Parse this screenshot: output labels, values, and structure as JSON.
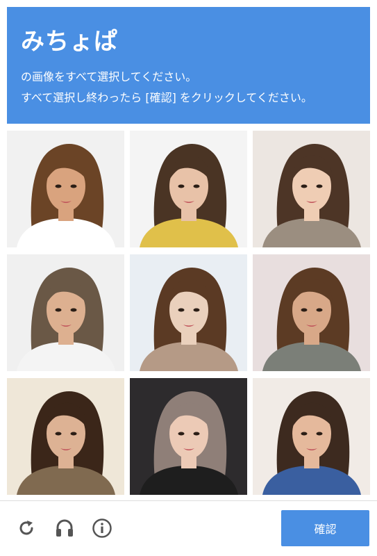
{
  "header": {
    "title": "みちょぱ",
    "instruction_line1": "の画像をすべて選択してください。",
    "instruction_line2": "すべて選択し終わったら [確認] をクリックしてください。"
  },
  "grid": {
    "rows": 3,
    "cols": 3,
    "tiles": [
      {
        "bg": "#f1f1f1",
        "hair": "#6b4426",
        "skin": "#d9a37e",
        "top": "#ffffff"
      },
      {
        "bg": "#f4f4f4",
        "hair": "#4a3424",
        "skin": "#e8c2a8",
        "top": "#e0c04a"
      },
      {
        "bg": "#ece6e1",
        "hair": "#4d3526",
        "skin": "#efcdb4",
        "top": "#9b8e80"
      },
      {
        "bg": "#f0f0f0",
        "hair": "#6a5846",
        "skin": "#ddb090",
        "top": "#f4f4f4"
      },
      {
        "bg": "#e9eef3",
        "hair": "#5b3a24",
        "skin": "#ead0bc",
        "top": "#b59a86"
      },
      {
        "bg": "#e8dede",
        "hair": "#5c3b24",
        "skin": "#d8a888",
        "top": "#7b7f78"
      },
      {
        "bg": "#efe7d8",
        "hair": "#3b2619",
        "skin": "#ddb294",
        "top": "#806a50"
      },
      {
        "bg": "#2d2b2d",
        "hair": "#8f7f78",
        "skin": "#eccab6",
        "top": "#1e1e1e"
      },
      {
        "bg": "#f1ebe6",
        "hair": "#3d2a1f",
        "skin": "#e5b99c",
        "top": "#3a5fa0"
      }
    ]
  },
  "footer": {
    "reload_icon": "reload-icon",
    "audio_icon": "headphones-icon",
    "info_icon": "info-icon",
    "verify_label": "確認"
  },
  "colors": {
    "accent": "#4a8fe3",
    "icon": "#555555",
    "divider": "#dcdcdc"
  }
}
